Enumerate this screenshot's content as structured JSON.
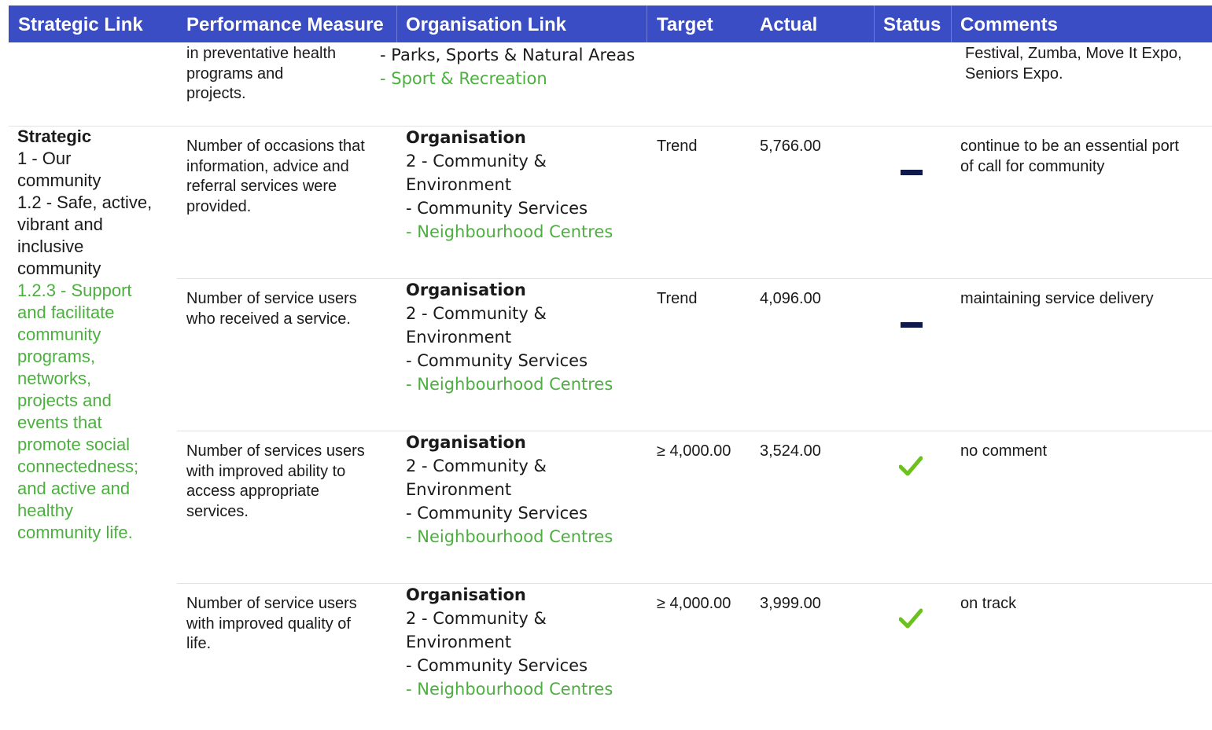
{
  "header": {
    "strategic_link": "Strategic Link",
    "performance_measure": "Performance Measure",
    "organisation_link": "Organisation Link",
    "target": "Target",
    "actual": "Actual",
    "status": "Status",
    "comments": "Comments"
  },
  "top_row": {
    "measure": [
      "in preventative health",
      "programs and",
      "projects."
    ],
    "org_line1": "- Parks, Sports & Natural Areas",
    "org_line2": "- Sport & Recreation",
    "comment": [
      "Festival, Zumba, Move It Expo,",
      "Seniors Expo."
    ]
  },
  "strategic": {
    "heading": "Strategic",
    "line1": "1 - Our",
    "line2": "community",
    "line3": "1.2 - Safe, active,",
    "line4": "vibrant and",
    "line5": "inclusive",
    "line6": "community",
    "green": [
      "1.2.3 - Support",
      "and facilitate",
      "community",
      "programs,",
      "networks,",
      "projects and",
      "events that",
      "promote social",
      "connectedness;",
      "and active and",
      "healthy",
      "community life."
    ]
  },
  "rows": [
    {
      "measure": [
        "Number of occasions that",
        "information, advice and",
        "referral services were",
        "provided."
      ],
      "org": [
        "Organisation",
        "2 - Community &",
        "Environment",
        "- Community Services",
        "- Neighbourhood Centres"
      ],
      "target": "Trend",
      "actual": "5,766.00",
      "status_icon": "dash-icon",
      "comment": [
        "continue to be an essential port",
        "of call for community"
      ]
    },
    {
      "measure": [
        "Number of service users",
        "who received a service."
      ],
      "org": [
        "Organisation",
        "2 - Community &",
        "Environment",
        "- Community Services",
        "- Neighbourhood Centres"
      ],
      "target": "Trend",
      "actual": "4,096.00",
      "status_icon": "dash-icon",
      "comment": [
        "maintaining service delivery"
      ]
    },
    {
      "measure": [
        "Number of services users",
        "with improved ability to",
        "access appropriate",
        "services."
      ],
      "org": [
        "Organisation",
        "2 - Community &",
        "Environment",
        "- Community Services",
        "- Neighbourhood Centres"
      ],
      "target": "≥ 4,000.00",
      "actual": "3,524.00",
      "status_icon": "checkmark-icon",
      "comment": [
        "no comment"
      ]
    },
    {
      "measure": [
        "Number of service users",
        "with improved quality of",
        "life."
      ],
      "org": [
        "Organisation",
        "2 - Community &",
        "Environment",
        "- Community Services",
        "- Neighbourhood Centres"
      ],
      "target": "≥ 4,000.00",
      "actual": "3,999.00",
      "status_icon": "checkmark-icon",
      "comment": [
        "on track"
      ]
    }
  ],
  "colors": {
    "header_bg": "#3a4dc4",
    "green_text": "#4caf3f",
    "dash": "#0f1a4a",
    "check": "#6cc11e"
  }
}
